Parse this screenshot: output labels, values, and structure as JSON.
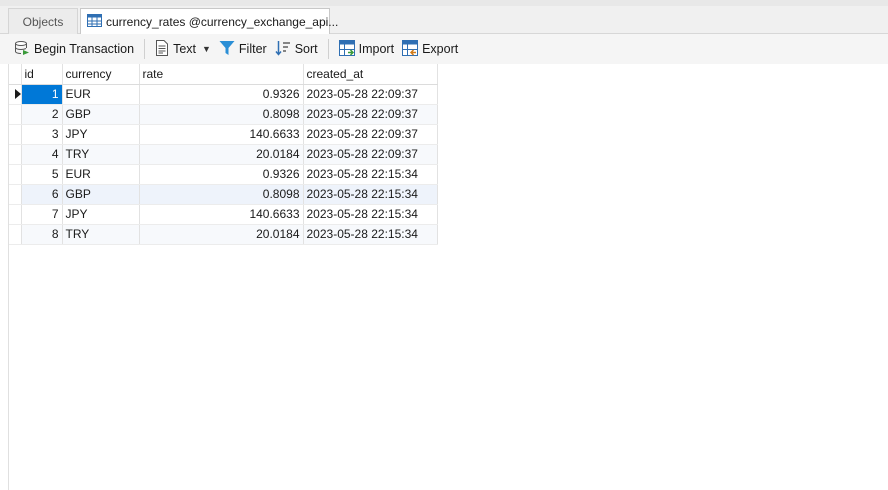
{
  "tabs": {
    "objects_label": "Objects",
    "active_label": "currency_rates @currency_exchange_api..."
  },
  "toolbar": {
    "begin_transaction": "Begin Transaction",
    "text": "Text",
    "filter": "Filter",
    "sort": "Sort",
    "import": "Import",
    "export": "Export"
  },
  "grid": {
    "columns": [
      "id",
      "currency",
      "rate",
      "created_at"
    ],
    "rows": [
      [
        "1",
        "EUR",
        "0.9326",
        "2023-05-28 22:09:37"
      ],
      [
        "2",
        "GBP",
        "0.8098",
        "2023-05-28 22:09:37"
      ],
      [
        "3",
        "JPY",
        "140.6633",
        "2023-05-28 22:09:37"
      ],
      [
        "4",
        "TRY",
        "20.0184",
        "2023-05-28 22:09:37"
      ],
      [
        "5",
        "EUR",
        "0.9326",
        "2023-05-28 22:15:34"
      ],
      [
        "6",
        "GBP",
        "0.8098",
        "2023-05-28 22:15:34"
      ],
      [
        "7",
        "JPY",
        "140.6633",
        "2023-05-28 22:15:34"
      ],
      [
        "8",
        "TRY",
        "20.0184",
        "2023-05-28 22:15:34"
      ]
    ]
  },
  "colors": {
    "selection": "#0078d7",
    "table_icon": "#2f6fb3",
    "filter_icon": "#2b8fd6",
    "sort_icon": "#2f6fb3"
  },
  "icons": {
    "begin_transaction": "database-transaction-icon",
    "text": "text-document-icon",
    "filter": "funnel-icon",
    "sort": "sort-icon",
    "import": "import-icon",
    "export": "export-icon",
    "tab": "table-icon"
  }
}
